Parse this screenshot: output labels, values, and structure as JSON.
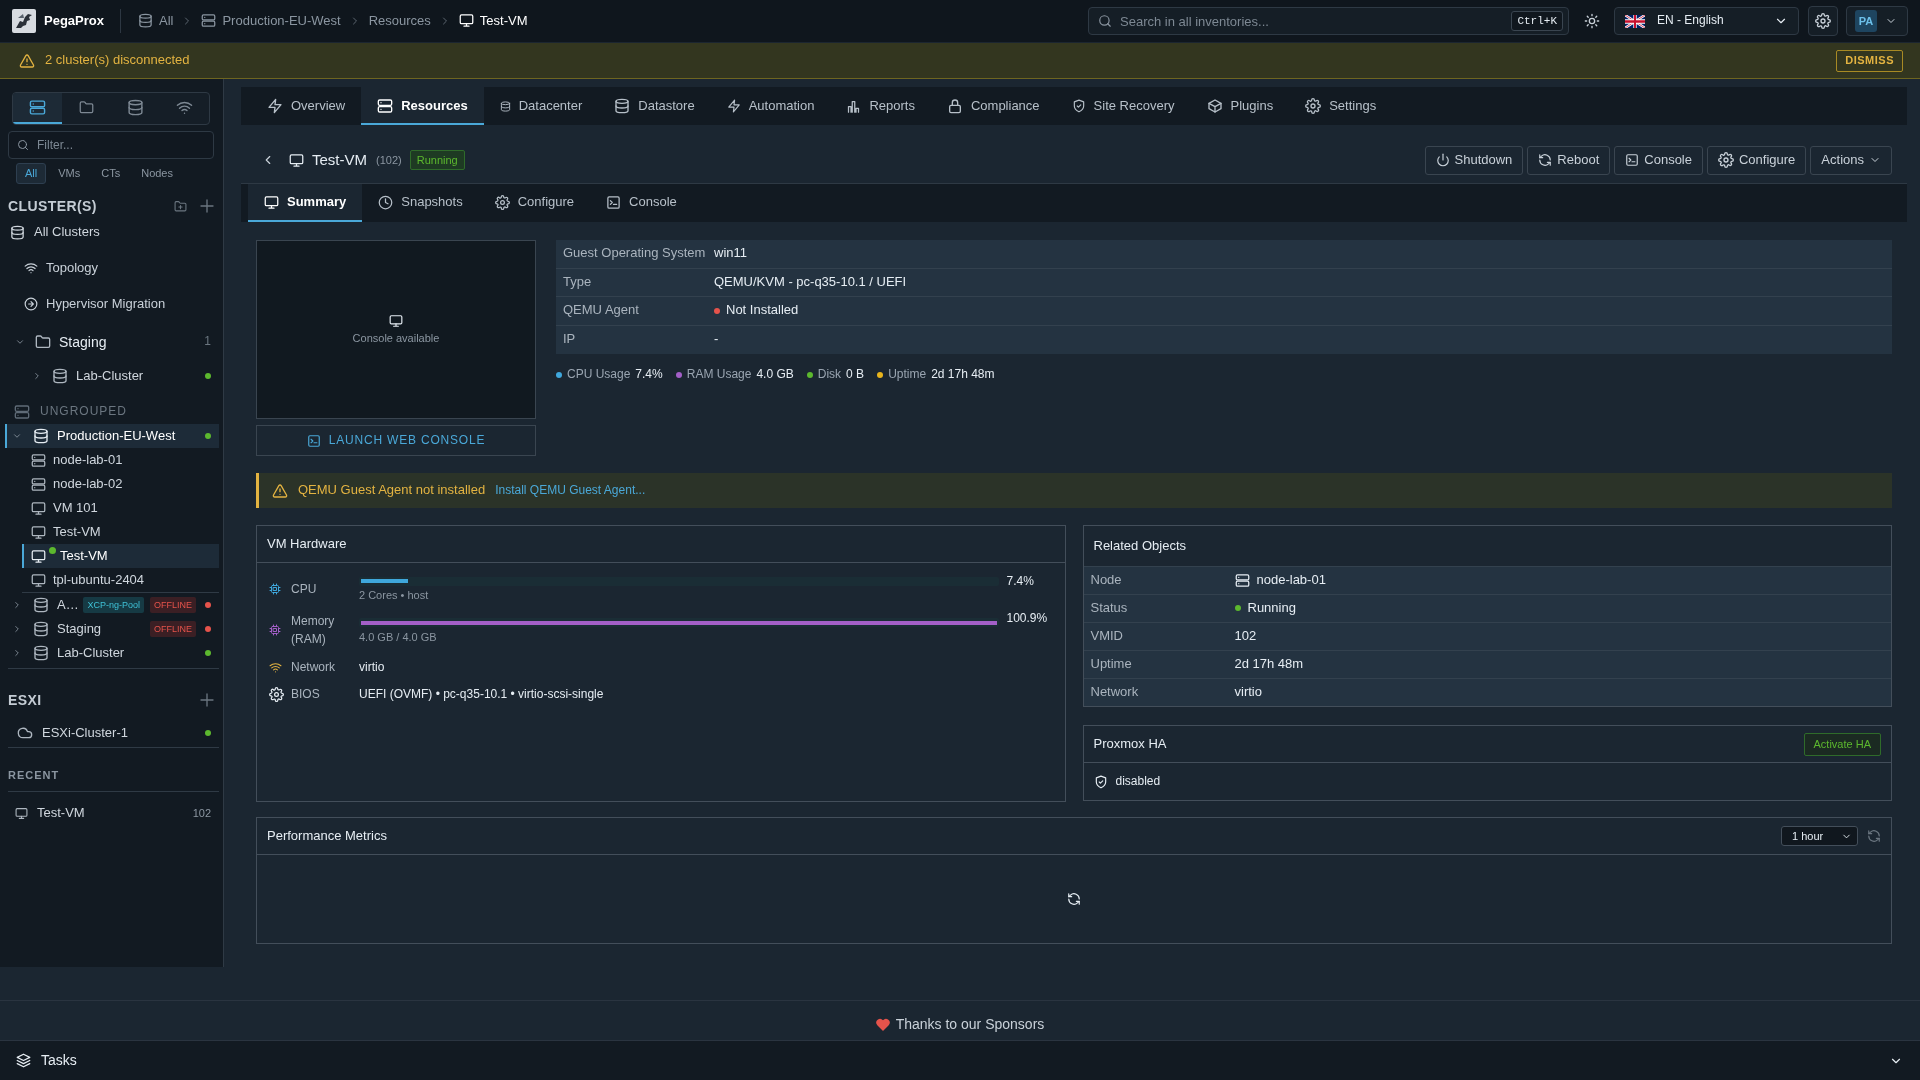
{
  "top_bar": {
    "brand": "PegaProx",
    "breadcrumbs": [
      {
        "label": "All",
        "current": false
      },
      {
        "label": "Production-EU-West",
        "current": false
      },
      {
        "label": "Resources",
        "current": false
      },
      {
        "label": "Test-VM",
        "current": true
      }
    ],
    "search": {
      "placeholder": "Search in all inventories...",
      "shortcut": "Ctrl+K"
    },
    "language": {
      "value": "EN - English"
    },
    "user": {
      "initials": "PA"
    }
  },
  "alert_banner": {
    "message": "2 cluster(s) disconnected",
    "dismiss": "DISMISS"
  },
  "sidebar": {
    "view_tabs": [
      {
        "selected": true
      },
      {
        "selected": false
      },
      {
        "selected": false
      },
      {
        "selected": false
      }
    ],
    "filter": {
      "placeholder": "Filter..."
    },
    "filter_chips": [
      {
        "label": "All",
        "selected": true
      },
      {
        "label": "VMs",
        "selected": false
      },
      {
        "label": "CTs",
        "selected": false
      },
      {
        "label": "Nodes",
        "selected": false
      }
    ],
    "clusters_section": {
      "title": "CLUSTER(S)",
      "links": [
        {
          "label": "All Clusters"
        },
        {
          "label": "Topology"
        },
        {
          "label": "Hypervisor Migration"
        }
      ],
      "groups": [
        {
          "label": "Staging",
          "count": "1",
          "expanded": true,
          "children": [
            {
              "label": "Lab-Cluster",
              "expanded": false,
              "color": "#5cb82e"
            }
          ]
        }
      ],
      "ungrouped": {
        "title": "UNGROUPED",
        "clusters": [
          {
            "label": "Production-EU-West",
            "expanded": true,
            "selected": true,
            "color": "#5cb82e",
            "children": [
              {
                "label": "node-lab-01",
                "kind": "node",
                "selected": false,
                "running": false
              },
              {
                "label": "node-lab-02",
                "kind": "node",
                "selected": false,
                "running": false
              },
              {
                "label": "VM 101",
                "kind": "vm",
                "selected": false,
                "running": false
              },
              {
                "label": "Test-VM",
                "kind": "vm",
                "selected": false,
                "running": false
              },
              {
                "label": "Test-VM",
                "kind": "vm",
                "selected": true,
                "running": true
              },
              {
                "label": "tpl-ubuntu-2404",
                "kind": "vm",
                "selected": false,
                "running": false
              }
            ]
          },
          {
            "label": "A…",
            "expanded": false,
            "selected": false,
            "color": "#e5534b",
            "tags": [
              {
                "label": "XCP-ng-Pool",
                "kind": "pool"
              },
              {
                "label": "OFFLINE",
                "kind": "offline"
              }
            ]
          },
          {
            "label": "Staging",
            "expanded": false,
            "selected": false,
            "color": "#e5534b",
            "tags": [
              {
                "label": "OFFLINE",
                "kind": "offline"
              }
            ]
          },
          {
            "label": "Lab-Cluster",
            "expanded": false,
            "selected": false,
            "color": "#5cb82e"
          }
        ]
      }
    },
    "esxi_section": {
      "title": "ESXI",
      "items": [
        {
          "label": "ESXi-Cluster-1",
          "color": "#5cb82e"
        }
      ]
    },
    "recent_section": {
      "title": "RECENT",
      "items": [
        {
          "label": "Test-VM",
          "vmid": "102"
        }
      ]
    }
  },
  "main_tabs": [
    {
      "label": "Overview",
      "selected": false
    },
    {
      "label": "Resources",
      "selected": true
    },
    {
      "label": "Datacenter",
      "selected": false
    },
    {
      "label": "Datastore",
      "selected": false
    },
    {
      "label": "Automation",
      "selected": false
    },
    {
      "label": "Reports",
      "selected": false
    },
    {
      "label": "Compliance",
      "selected": false
    },
    {
      "label": "Site Recovery",
      "selected": false
    },
    {
      "label": "Plugins",
      "selected": false
    },
    {
      "label": "Settings",
      "selected": false
    }
  ],
  "vm_header": {
    "name": "Test-VM",
    "vmid": "(102)",
    "status": "Running",
    "actions": [
      {
        "label": "Shutdown",
        "kind": "button"
      },
      {
        "label": "Reboot",
        "kind": "button"
      },
      {
        "label": "Console",
        "kind": "button"
      },
      {
        "label": "Configure",
        "kind": "button"
      },
      {
        "label": "Actions",
        "kind": "dropdown"
      }
    ]
  },
  "sub_tabs": [
    {
      "label": "Summary",
      "selected": true
    },
    {
      "label": "Snapshots",
      "selected": false
    },
    {
      "label": "Configure",
      "selected": false
    },
    {
      "label": "Console",
      "selected": false
    }
  ],
  "console_preview": {
    "caption": "Console available",
    "button": "LAUNCH WEB CONSOLE"
  },
  "guest_info": {
    "rows": [
      {
        "label": "Guest Operating System",
        "value": "win11"
      },
      {
        "label": "Type",
        "value": "QEMU/KVM - pc-q35-10.1 / UEFI"
      },
      {
        "label": "QEMU Agent",
        "value": "Not Installed",
        "color": "#e5534b"
      },
      {
        "label": "IP",
        "value": "-"
      }
    ]
  },
  "usage_stats": [
    {
      "label": "CPU Usage",
      "value": "7.4%",
      "color": "#3fa7dc"
    },
    {
      "label": "RAM Usage",
      "value": "4.0 GB",
      "color": "#a35fc7"
    },
    {
      "label": "Disk",
      "value": "0 B",
      "color": "#5cb82e"
    },
    {
      "label": "Uptime",
      "value": "2d 17h 48m",
      "color": "#e8b41c"
    }
  ],
  "agent_warning": {
    "message": "QEMU Guest Agent not installed",
    "link": "Install QEMU Guest Agent..."
  },
  "vm_hardware": {
    "title": "VM Hardware",
    "rows": [
      {
        "kind": "meter",
        "label": "CPU",
        "level": 0.074,
        "reading": "7.4%",
        "detail": "2 Cores • host",
        "color": "#3fa7dc"
      },
      {
        "kind": "meter",
        "label": "Memory (RAM)",
        "level": 1,
        "reading": "100.9%",
        "detail": "4.0 GB / 4.0 GB",
        "color": "#a35fc7"
      },
      {
        "kind": "text",
        "label": "Network",
        "value": "virtio"
      },
      {
        "kind": "text",
        "label": "BIOS",
        "value": "UEFI (OVMF) • pc-q35-10.1 • virtio-scsi-single"
      }
    ]
  },
  "related_objects": {
    "title": "Related Objects",
    "rows": [
      {
        "kind": "node",
        "label": "Node",
        "value": "node-lab-01"
      },
      {
        "kind": "status",
        "label": "Status",
        "value": "Running",
        "color": "#5cb82e"
      },
      {
        "kind": "text",
        "label": "VMID",
        "value": "102"
      },
      {
        "kind": "text",
        "label": "Uptime",
        "value": "2d 17h 48m"
      },
      {
        "kind": "text",
        "label": "Network",
        "value": "virtio"
      }
    ]
  },
  "proxmox_ha": {
    "title": "Proxmox HA",
    "button": "Activate HA",
    "status": "disabled"
  },
  "performance_metrics": {
    "title": "Performance Metrics",
    "range": "1 hour",
    "loading": true
  },
  "footer": {
    "sponsors": "Thanks to our Sponsors"
  },
  "tasks_bar": {
    "title": "Tasks"
  }
}
